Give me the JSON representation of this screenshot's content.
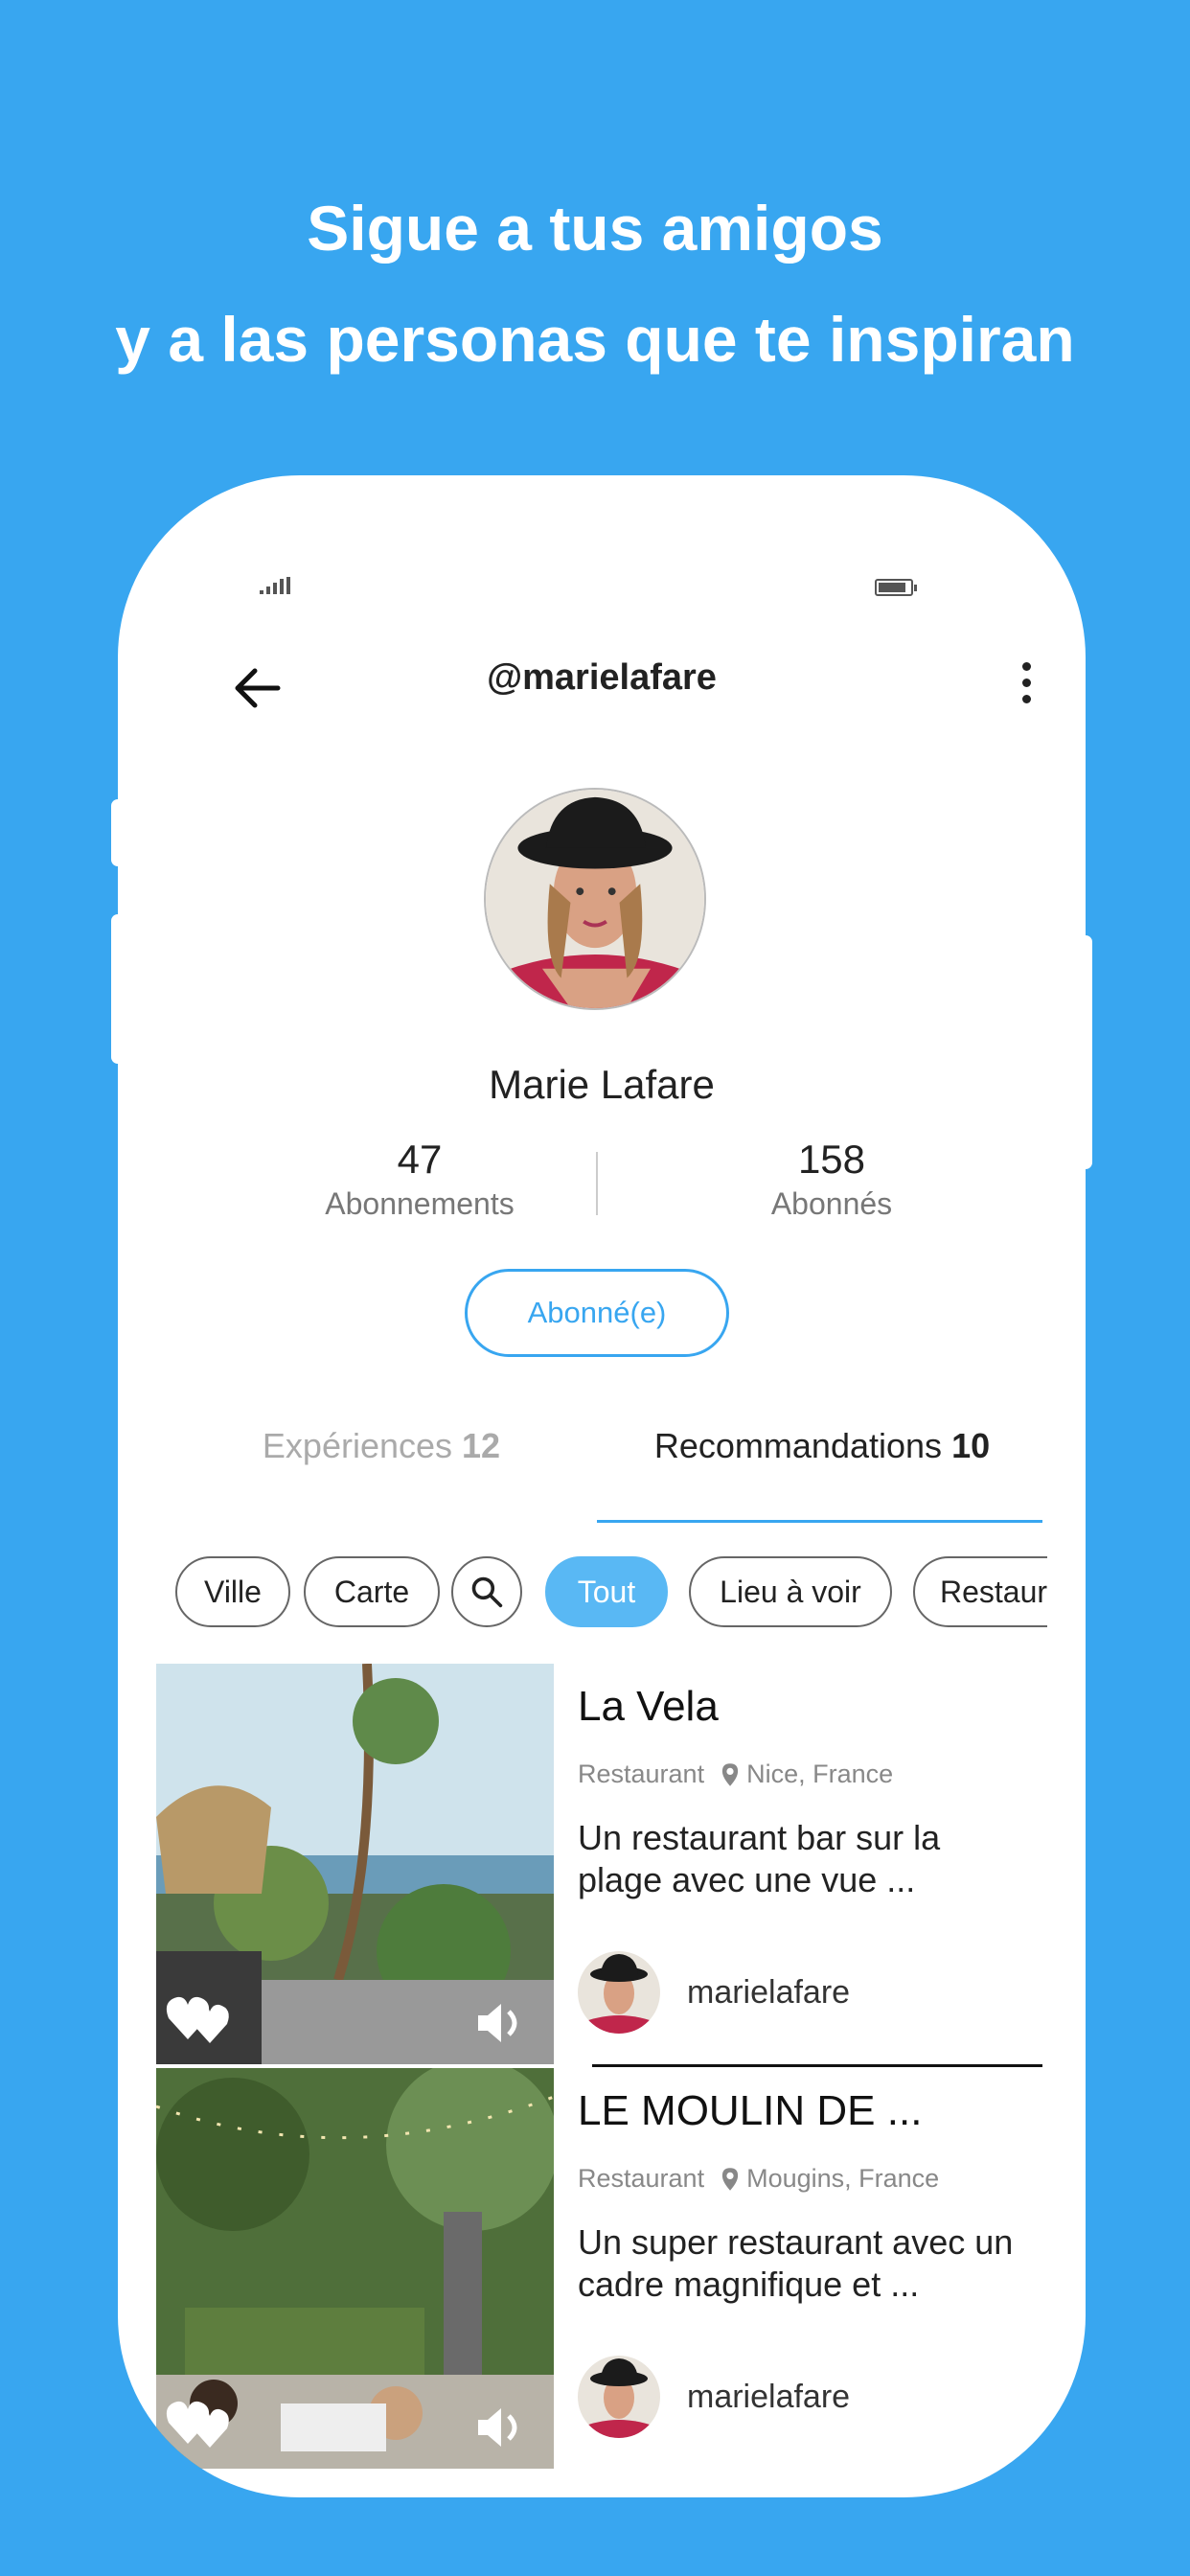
{
  "promo": {
    "line1": "Sigue a tus amigos",
    "line2": "y a las personas que te inspiran"
  },
  "colors": {
    "background": "#38a6f0",
    "accent": "#38a6f0",
    "active_pill": "#59b8f4"
  },
  "header": {
    "back_icon": "arrow-left-icon",
    "handle": "@marielafare",
    "more_icon": "more-vertical-icon"
  },
  "profile": {
    "name": "Marie Lafare",
    "following_count": "47",
    "following_label": "Abonnements",
    "followers_count": "158",
    "followers_label": "Abonnés",
    "follow_button": "Abonné(e)"
  },
  "tabs": [
    {
      "label": "Expériences",
      "count": "12",
      "active": false
    },
    {
      "label": "Recommandations",
      "count": "10",
      "active": true
    }
  ],
  "filters": {
    "ville": "Ville",
    "carte": "Carte",
    "search_icon": "search-icon",
    "tout": "Tout",
    "lieu": "Lieu à voir",
    "restau": "Restaurant",
    "active": "Tout"
  },
  "cards": [
    {
      "title": "La Vela",
      "category": "Restaurant",
      "location": "Nice, France",
      "description": "Un restaurant bar sur la plage avec une vue ...",
      "user": "marielafare"
    },
    {
      "title": "LE MOULIN DE ...",
      "category": "Restaurant",
      "location": "Mougins, France",
      "description": "Un super restaurant avec un cadre magnifique et ...",
      "user": "marielafare"
    }
  ]
}
